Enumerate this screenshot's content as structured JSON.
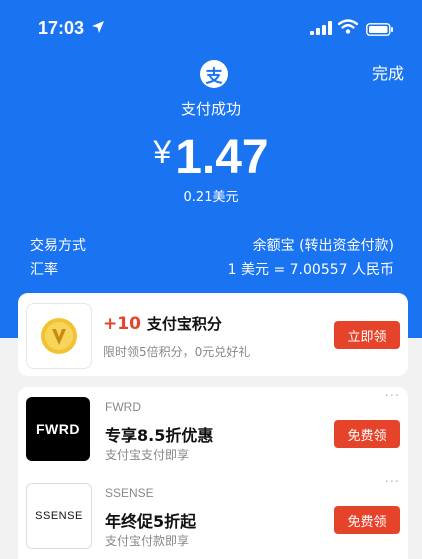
{
  "status_bar": {
    "time": "17:03"
  },
  "header": {
    "done_label": "完成",
    "logo_char": "支",
    "status_text": "支付成功"
  },
  "payment": {
    "currency_symbol": "¥",
    "amount": "1.47",
    "usd": "0.21美元"
  },
  "details": {
    "method_label": "交易方式",
    "method_value": "余额宝 (转出资金付款)",
    "rate_label": "汇率",
    "rate_value": "1 美元 = 7.00557 人民币"
  },
  "points": {
    "amount": "+10",
    "title": "支付宝积分",
    "subtitle": "限时领5倍积分，0元兑好礼",
    "button": "立即领"
  },
  "merchants": [
    {
      "logo": "FWRD",
      "name": "FWRD",
      "offer": "专享8.5折优惠",
      "desc": "支付宝支付即享",
      "button": "免费领",
      "more": "···"
    },
    {
      "logo": "SSENSE",
      "name": "SSENSE",
      "offer": "年终促5折起",
      "desc": "支付宝付款即享",
      "button": "免费领",
      "more": "···"
    }
  ],
  "colors": {
    "primary": "#1a73f0",
    "accent": "#e5432a"
  }
}
